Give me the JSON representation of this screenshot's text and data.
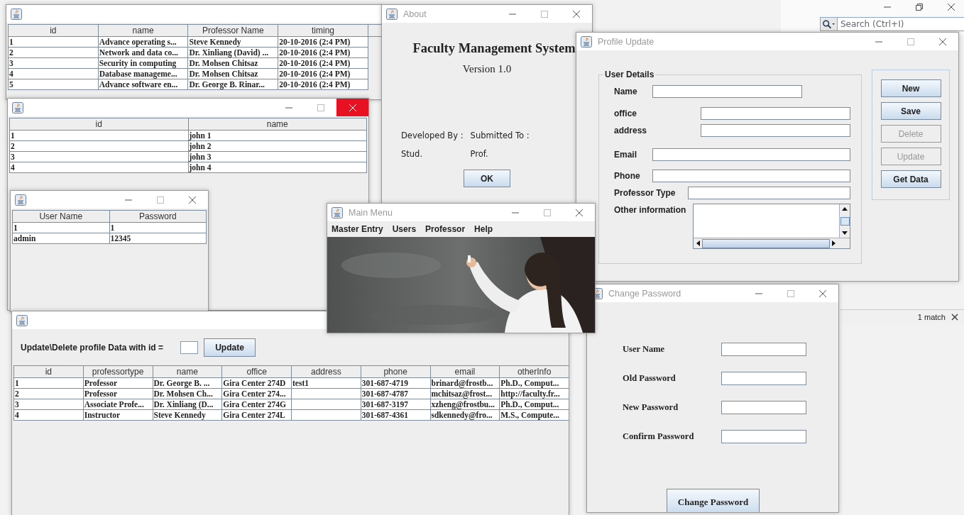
{
  "ide": {
    "search_placeholder": "Search (Ctrl+I)",
    "find_result": "1 match"
  },
  "courses_window": {
    "table": {
      "columns": [
        "id",
        "name",
        "Professor Name",
        "timing"
      ],
      "rows": [
        [
          "1",
          "Advance operating s...",
          "Steve Kennedy",
          "20-10-2016 (2:4 PM)"
        ],
        [
          "2",
          "Network and data co...",
          "Dr. Xinliang (David) ...",
          "20-10-2016 (2:4 PM)"
        ],
        [
          "3",
          "Security in computing",
          "Dr. Mohsen Chitsaz",
          "20-10-2016 (2:4 PM)"
        ],
        [
          "4",
          "Database manageme...",
          "Dr. Mohsen Chitsaz",
          "20-10-2016 (2:4 PM)"
        ],
        [
          "5",
          "Advance software en...",
          "Dr. George B. Rinar...",
          "20-10-2016 (2:4 PM)"
        ]
      ]
    }
  },
  "names_window": {
    "close_highlighted": true,
    "table": {
      "columns": [
        "id",
        "name"
      ],
      "rows": [
        [
          "1",
          "john 1"
        ],
        [
          "2",
          "john 2"
        ],
        [
          "3",
          "john 3"
        ],
        [
          "4",
          "john 4"
        ]
      ]
    }
  },
  "users_window": {
    "table": {
      "columns": [
        "User Name",
        "Password"
      ],
      "rows": [
        [
          "1",
          "1"
        ],
        [
          "admin",
          "12345"
        ]
      ]
    }
  },
  "about_window": {
    "title": "About",
    "heading": "Faculty Management System",
    "version": "Version 1.0",
    "credits": [
      {
        "label": "Developed By :",
        "value": "Stud."
      },
      {
        "label": "Submitted To :",
        "value": "Prof."
      }
    ],
    "ok_button": "OK"
  },
  "profile_window": {
    "title": "Profile Update",
    "group_title": "User Details",
    "fields": [
      {
        "label": "Name",
        "kind": "text"
      },
      {
        "label": "office",
        "kind": "text"
      },
      {
        "label": "address",
        "kind": "text"
      },
      {
        "label": "Email",
        "kind": "text"
      },
      {
        "label": "Phone",
        "kind": "text"
      },
      {
        "label": "Professor Type",
        "kind": "text"
      },
      {
        "label": "Other information",
        "kind": "textarea"
      }
    ],
    "buttons": [
      {
        "label": "New",
        "disabled": false
      },
      {
        "label": "Save",
        "disabled": false
      },
      {
        "label": "Delete",
        "disabled": true
      },
      {
        "label": "Update",
        "disabled": true
      },
      {
        "label": "Get Data",
        "disabled": false
      }
    ]
  },
  "update_window": {
    "prompt": "Update\\Delete profile Data with id =",
    "button": "Update",
    "table": {
      "columns": [
        "id",
        "professortype",
        "name",
        "office",
        "address",
        "phone",
        "email",
        "otherInfo"
      ],
      "rows": [
        [
          "1",
          "Professor",
          "Dr. George B. ...",
          "Gira Center 274D",
          "test1",
          "301-687-4719",
          "brinard@frostb...",
          "Ph.D., Comput..."
        ],
        [
          "2",
          "Professor",
          "Dr. Mohsen Ch...",
          "Gira Center 274...",
          "",
          "301-687-4787",
          "mchitsaz@frost...",
          "http://faculty.fr..."
        ],
        [
          "3",
          "Associate Profe...",
          "Dr. Xinliang (D...",
          "Gira Center 274G",
          "",
          "301-687-3197",
          "xzheng@frostbu...",
          "Ph.D., Comput..."
        ],
        [
          "4",
          "Instructor",
          "Steve Kennedy",
          "Gira Center 274L",
          "",
          "301-687-4361",
          "sdkennedy@fro...",
          "M.S., Compute..."
        ]
      ]
    }
  },
  "main_menu_window": {
    "title": "Main Menu",
    "menus": [
      "Master Entry",
      "Users",
      "Professor",
      "Help"
    ]
  },
  "change_password_window": {
    "title": "Change Password",
    "fields": [
      "User Name",
      "Old Password",
      "New Password",
      "Confirm Password"
    ],
    "button": "Change Password"
  }
}
